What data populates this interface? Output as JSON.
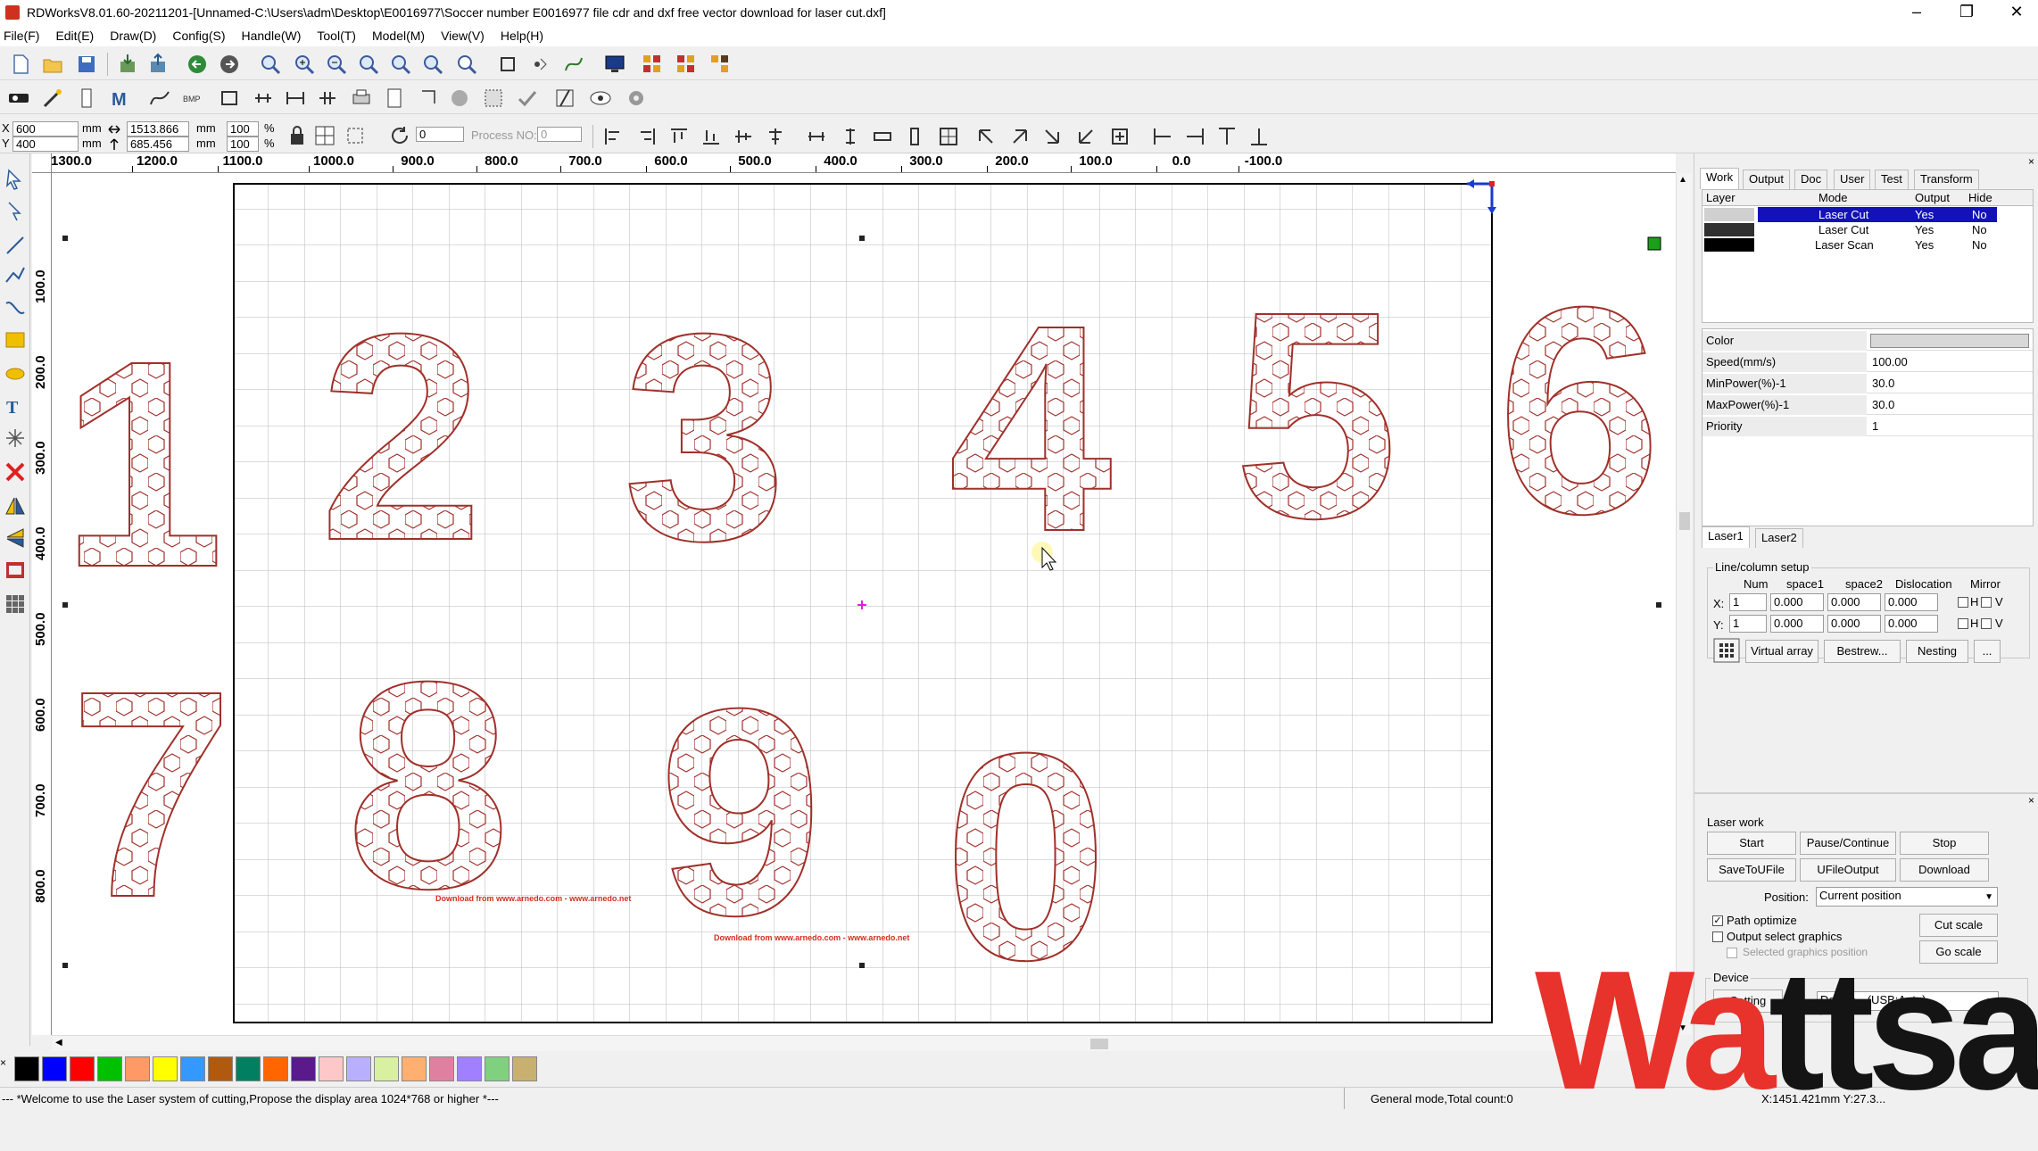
{
  "window": {
    "title": "RDWorksV8.01.60-20211201-[Unnamed-C:\\Users\\adm\\Desktop\\E0016977\\Soccer number E0016977 file cdr and dxf free vector download for laser cut.dxf]",
    "minimize": "–",
    "maximize": "❐",
    "close": "✕"
  },
  "menu": [
    "File(F)",
    "Edit(E)",
    "Draw(D)",
    "Config(S)",
    "Handle(W)",
    "Tool(T)",
    "Model(M)",
    "View(V)",
    "Help(H)"
  ],
  "props": {
    "x_label": "X",
    "x_value": "600",
    "x_unit": "mm",
    "y_label": "Y",
    "y_value": "400",
    "y_unit": "mm",
    "w_value": "1513.866",
    "w_unit": "mm",
    "h_value": "685.456",
    "h_unit": "mm",
    "sx_value": "100",
    "sx_unit": "%",
    "sy_value": "100",
    "sy_unit": "%",
    "rotate_value": "0",
    "process_no_label": "Process NO:",
    "process_no_value": "0"
  },
  "ruler": {
    "h_ticks": [
      "1300.0",
      "1200.0",
      "1100.0",
      "1000.0",
      "900.0",
      "800.0",
      "700.0",
      "600.0",
      "500.0",
      "400.0",
      "300.0",
      "200.0",
      "100.0",
      "0.0",
      "-100.0"
    ],
    "v_ticks": [
      "100.0",
      "200.0",
      "300.0",
      "400.0",
      "500.0",
      "600.0",
      "700.0",
      "800.0"
    ]
  },
  "canvas": {
    "digits": [
      "1",
      "2",
      "3",
      "4",
      "5",
      "6",
      "7",
      "8",
      "9",
      "0"
    ],
    "credit_1": "Download from www.arnedo.com - www.arnedo.net",
    "credit_2": "Download from www.arnedo.com - www.arnedo.net",
    "line_color": "#a0302a"
  },
  "panel": {
    "tabs": [
      "Work",
      "Output",
      "Doc",
      "User",
      "Test",
      "Transform"
    ],
    "layer_headers": [
      "Layer",
      "Mode",
      "Output",
      "Hide"
    ],
    "layers": [
      {
        "mode": "Laser Cut",
        "output": "Yes",
        "hide": "No",
        "color": "#d0d0d0",
        "selected": true
      },
      {
        "mode": "Laser Cut",
        "output": "Yes",
        "hide": "No",
        "color": "#303030",
        "selected": false
      },
      {
        "mode": "Laser Scan",
        "output": "Yes",
        "hide": "No",
        "color": "#000000",
        "selected": false
      }
    ],
    "params": [
      {
        "name": "Color",
        "value": ""
      },
      {
        "name": "Speed(mm/s)",
        "value": "100.00"
      },
      {
        "name": "MinPower(%)-1",
        "value": "30.0"
      },
      {
        "name": "MaxPower(%)-1",
        "value": "30.0"
      },
      {
        "name": "Priority",
        "value": "1"
      }
    ],
    "laser_tabs": [
      "Laser1",
      "Laser2"
    ],
    "line_column": {
      "title": "Line/column setup",
      "headers": [
        "Num",
        "space1",
        "space2",
        "Dislocation",
        "Mirror"
      ],
      "x_label": "X:",
      "x_num": "1",
      "x_space1": "0.000",
      "x_space2": "0.000",
      "x_disloc": "0.000",
      "y_label": "Y:",
      "y_num": "1",
      "y_space1": "0.000",
      "y_space2": "0.000",
      "y_disloc": "0.000",
      "mirror_h": "H",
      "mirror_v": "V",
      "virtual_array": "Virtual array",
      "bestrew": "Bestrew...",
      "nesting": "Nesting",
      "more": "..."
    },
    "laser_work": {
      "title": "Laser work",
      "start": "Start",
      "pause": "Pause/Continue",
      "stop": "Stop",
      "save_to_file": "SaveToUFile",
      "ufile_output": "UFileOutput",
      "download": "Download",
      "position_label": "Position:",
      "position_value": "Current position",
      "path_optimize": "Path optimize",
      "output_select": "Output select graphics",
      "selected_pos": "Selected graphics position",
      "cut_scale": "Cut scale",
      "go_scale": "Go scale"
    },
    "device": {
      "title": "Device",
      "setting": "Setting",
      "value": "Device---(USB:Auto)"
    }
  },
  "palette": [
    "#000000",
    "#0000ff",
    "#ff0000",
    "#00c000",
    "#ff9966",
    "#ffff00",
    "#3399ff",
    "#b05a10",
    "#008060",
    "#ff6600",
    "#5a1a8c",
    "#ffc8c8",
    "#b8b0ff",
    "#d8f0a0",
    "#ffb070",
    "#e080a0",
    "#a080ff",
    "#80d080",
    "#c8b070"
  ],
  "status": {
    "message": "--- *Welcome to use the Laser system of cutting,Propose the display area 1024*768 or higher *---",
    "mode": "General mode,Total count:0",
    "coords": "X:1451.421mm Y:27.3..."
  },
  "watermark": {
    "text": "Wattsan",
    "red_part": "Wa",
    "black_part": "ttsan",
    "red": "#e8322c"
  }
}
